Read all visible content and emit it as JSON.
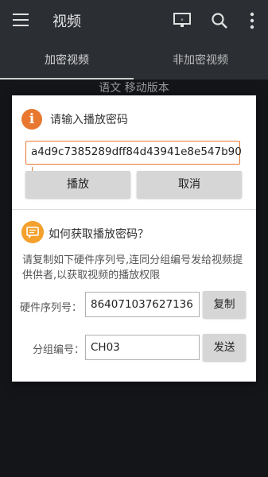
{
  "appbar": {
    "title": "视频",
    "icons": [
      "menu-icon",
      "cast-icon",
      "search-icon",
      "more-vert-icon"
    ]
  },
  "tabs": [
    {
      "label": "加密视频",
      "active": true
    },
    {
      "label": "非加密视频",
      "active": false
    }
  ],
  "background_text": "语文 移动版本",
  "dialog": {
    "title": "请输入播放密码",
    "password_value": "a4d9c7385289dff84d43941e8e547b90",
    "play_label": "播放",
    "cancel_label": "取消",
    "help_title": "如何获取播放密码？",
    "help_text": "请复制如下硬件序列号,连同分组编号发给视频提供供者,以获取视频的播放权限",
    "serial_label": "硬件序列号：",
    "serial_value": "864071037627136",
    "copy_label": "复制",
    "group_label": "分组编号：",
    "group_value": "CH03",
    "send_label": "发送"
  },
  "colors": {
    "accent": "#e8782f",
    "help_icon": "#f3a02c",
    "appbar": "#2b2e33",
    "page_bg": "#131519"
  }
}
